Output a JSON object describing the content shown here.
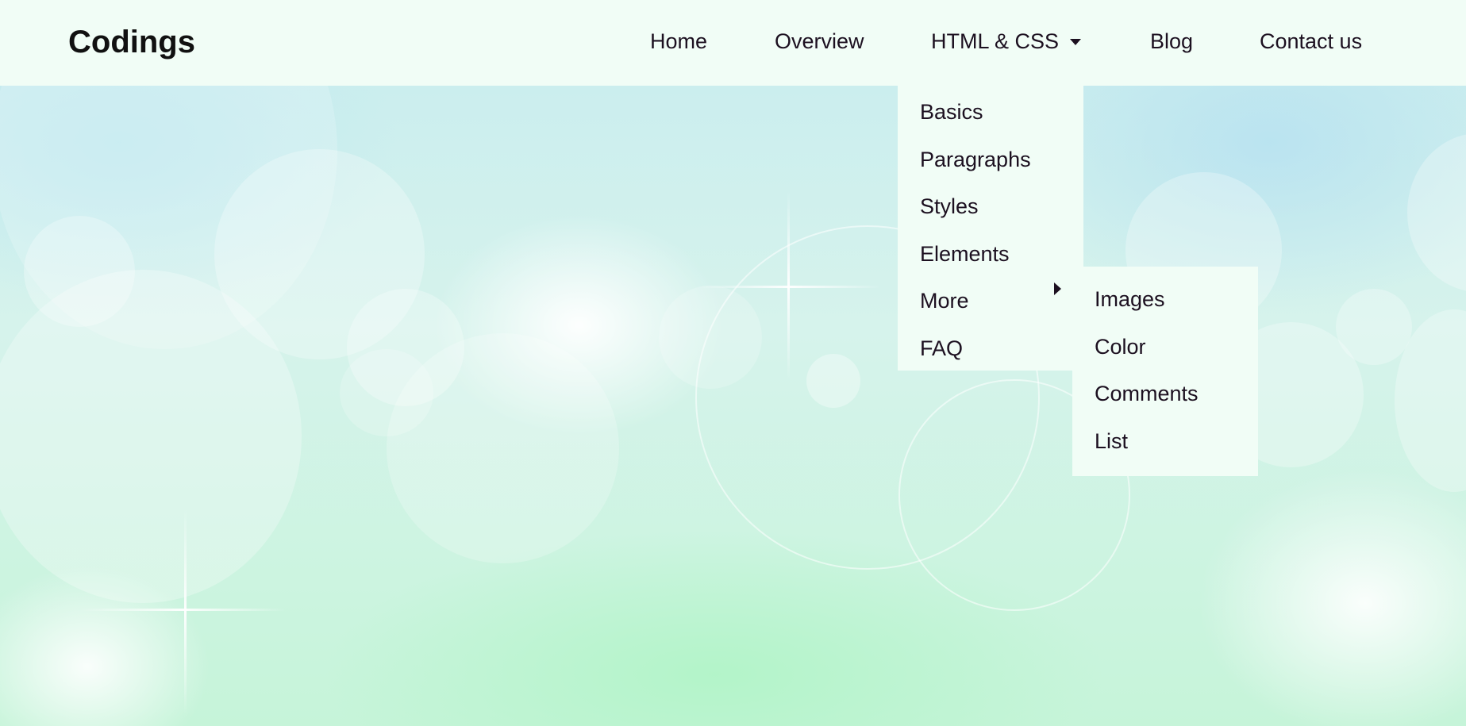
{
  "brand": {
    "name": "Codings"
  },
  "nav": {
    "items": [
      {
        "label": "Home"
      },
      {
        "label": "Overview"
      },
      {
        "label": "HTML & CSS"
      },
      {
        "label": "Blog"
      },
      {
        "label": "Contact us"
      }
    ]
  },
  "dropdown": {
    "items": [
      {
        "label": "Basics"
      },
      {
        "label": "Paragraphs"
      },
      {
        "label": "Styles"
      },
      {
        "label": "Elements"
      },
      {
        "label": "More"
      },
      {
        "label": "FAQ"
      }
    ]
  },
  "submenu": {
    "items": [
      {
        "label": "Images"
      },
      {
        "label": "Color"
      },
      {
        "label": "Comments"
      },
      {
        "label": "List"
      }
    ]
  },
  "icons": {
    "dropdown_caret": "caret-down-icon",
    "submenu_caret": "caret-right-icon"
  },
  "colors": {
    "header_bg": "#f1fdf6",
    "menu_bg": "#f1fdf6",
    "text": "#1c1020",
    "logo_text": "#111111"
  }
}
